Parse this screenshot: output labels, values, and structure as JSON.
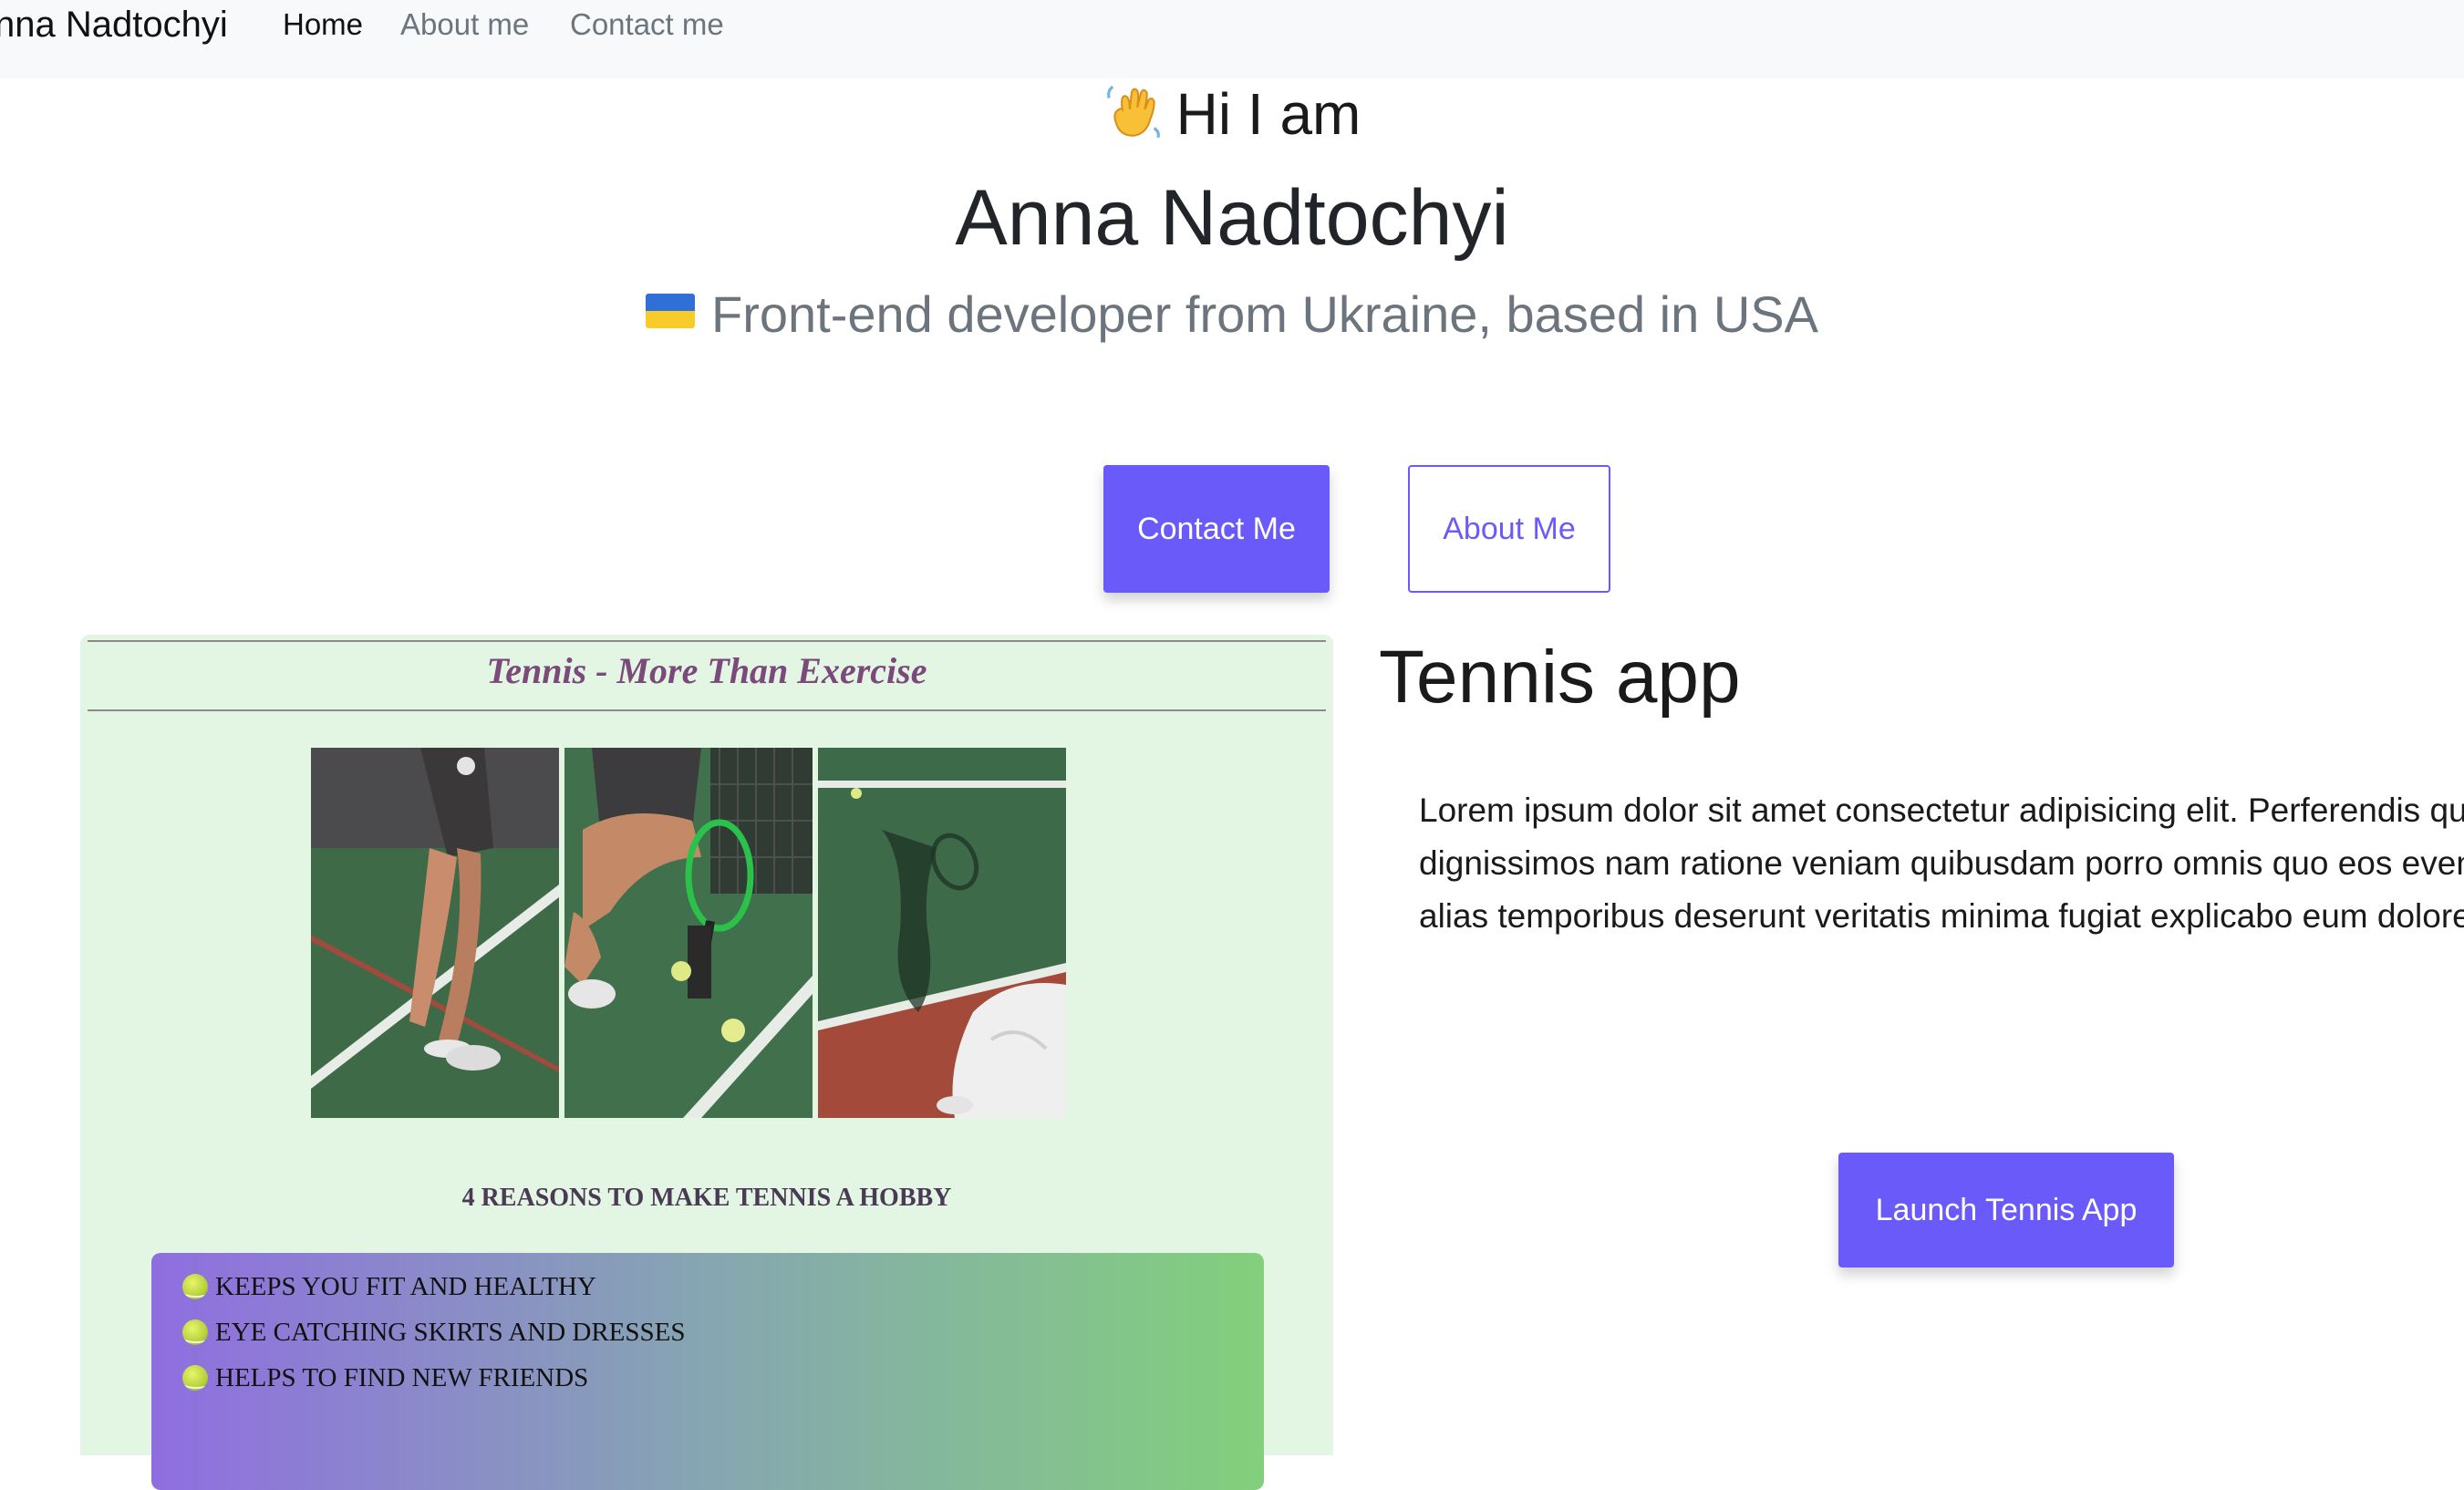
{
  "navbar": {
    "brand": "nna Nadtochyi",
    "links": [
      {
        "label": "Home",
        "active": true
      },
      {
        "label": "About me",
        "active": false
      },
      {
        "label": "Contact me",
        "active": false
      }
    ]
  },
  "hero": {
    "greeting_icon": "waving-hand-icon",
    "greeting": "Hi I am",
    "name": "Anna Nadtochyi",
    "subtitle_icon": "ukraine-flag-icon",
    "subtitle": "Front-end developer from Ukraine, based in USA",
    "contact_button": "Contact Me",
    "about_button": "About Me"
  },
  "tennis_card": {
    "title": "Tennis - More Than Exercise",
    "reasons_title": "4 REASONS TO MAKE TENNIS A HOBBY",
    "reasons": [
      "KEEPS YOU FIT AND HEALTHY",
      "EYE CATCHING SKIRTS AND DRESSES",
      "HELPS TO FIND NEW FRIENDS"
    ]
  },
  "tennis_app": {
    "heading": "Tennis app",
    "description": "Lorem ipsum dolor sit amet consectetur adipisicing elit. Perferendis quia, dignissimos nam ratione veniam quibusdam porro omnis quo eos eveniet alias temporibus deserunt veritatis minima fugiat explicabo eum dolore.",
    "launch_button": "Launch Tennis App"
  },
  "colors": {
    "primary": "#6a5af9",
    "card_background": "#e3f6e4",
    "card_title": "#7b4a7a",
    "navbar_background": "#f8f9fa",
    "muted_text": "#6c757d"
  }
}
